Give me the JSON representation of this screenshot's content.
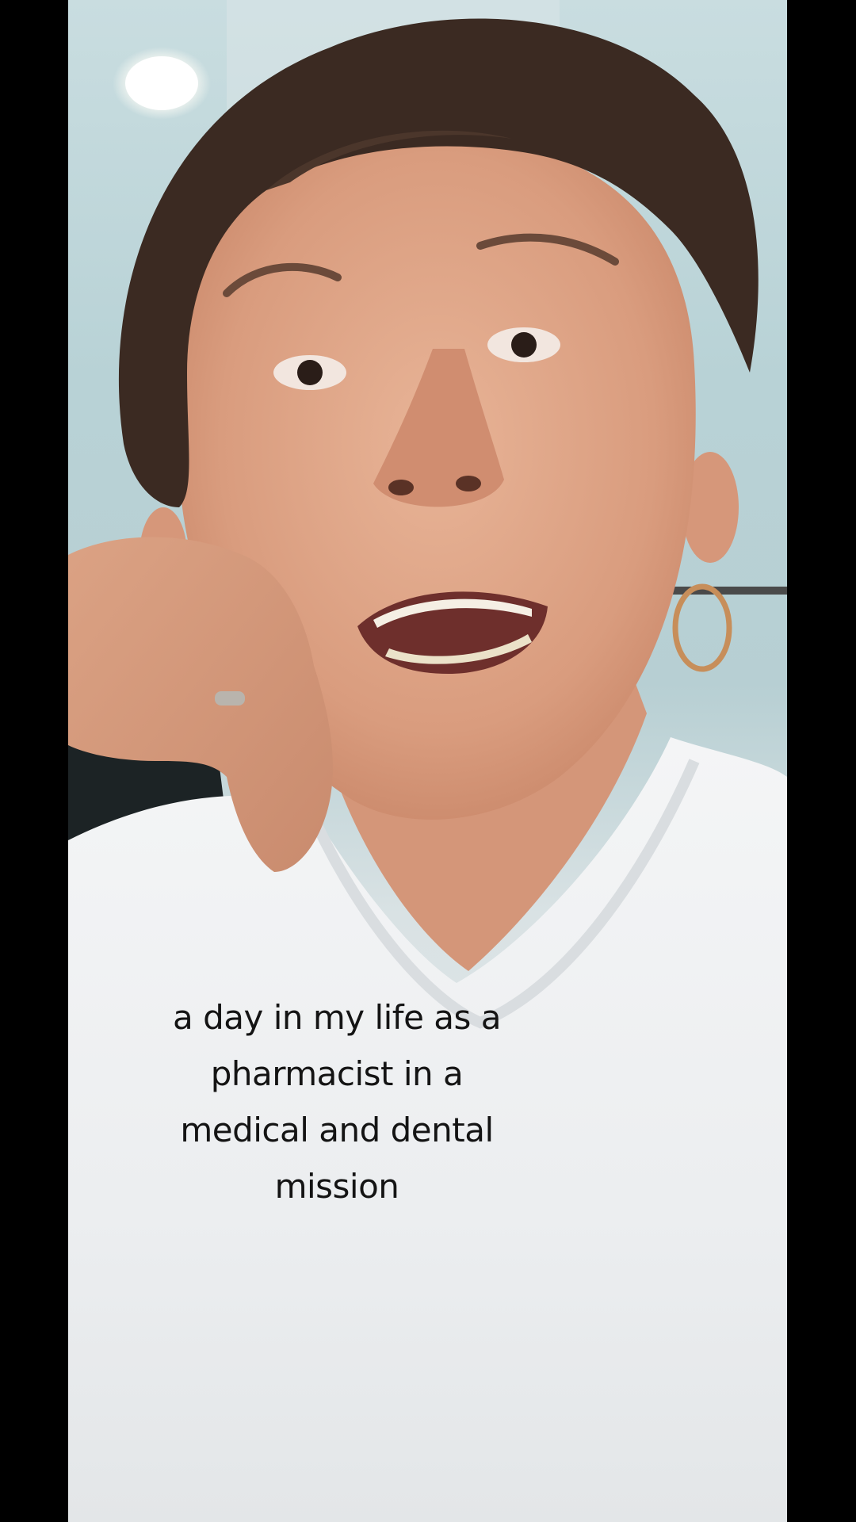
{
  "caption": {
    "lines": [
      "a day in my life as a",
      "pharmacist in a",
      "medical and dental",
      "mission"
    ]
  },
  "colors": {
    "letterbox": "#000000",
    "caption_text": "#141414",
    "shirt": "#eef0f2",
    "hair": "#3b2a22",
    "skin": "#e0a98c"
  },
  "icons": {
    "ceiling_light": "ceiling-light-icon"
  }
}
